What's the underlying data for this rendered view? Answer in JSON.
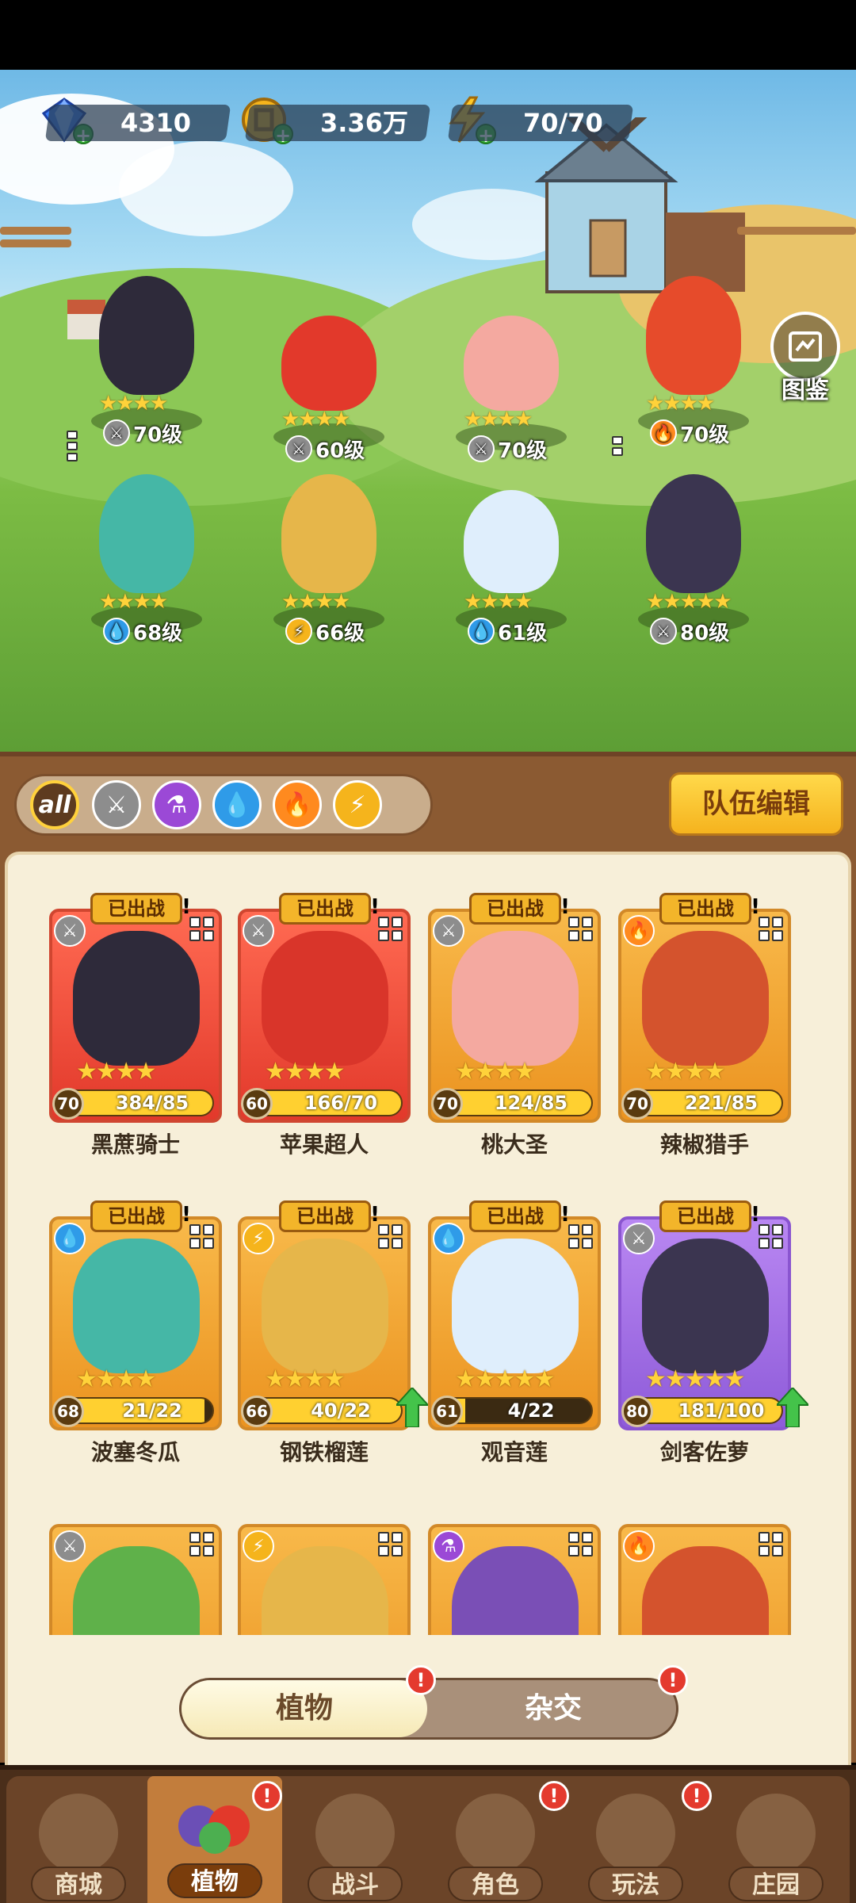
{
  "resources": {
    "gems": "4310",
    "coins": "3.36万",
    "energy": "70/70"
  },
  "atlas_label": "图鉴",
  "battle_units": [
    {
      "stars": "★★★★",
      "element": "sword",
      "level": "70级"
    },
    {
      "stars": "★★★★",
      "element": "sword",
      "level": "60级"
    },
    {
      "stars": "★★★★",
      "element": "sword",
      "level": "70级"
    },
    {
      "stars": "★★★★",
      "element": "fire",
      "level": "70级"
    },
    {
      "stars": "★★★★",
      "element": "water",
      "level": "68级"
    },
    {
      "stars": "★★★★",
      "element": "bolt",
      "level": "66级"
    },
    {
      "stars": "★★★★",
      "element": "water",
      "level": "61级"
    },
    {
      "stars": "★★★★★",
      "element": "sword",
      "level": "80级"
    }
  ],
  "filters": {
    "all_label": "all",
    "icons": [
      "sword-icon",
      "potion-icon",
      "water-icon",
      "fire-icon",
      "bolt-icon"
    ]
  },
  "team_edit_label": "队伍编辑",
  "cards": [
    {
      "tag": "已出战",
      "name": "黑蔗骑士",
      "level": "70",
      "progress": "384/85",
      "fill": 1.0,
      "stars": "★★★★",
      "color": "red",
      "element": "sword"
    },
    {
      "tag": "已出战",
      "name": "苹果超人",
      "level": "60",
      "progress": "166/70",
      "fill": 1.0,
      "stars": "★★★★",
      "color": "red",
      "element": "sword"
    },
    {
      "tag": "已出战",
      "name": "桃大圣",
      "level": "70",
      "progress": "124/85",
      "fill": 1.0,
      "stars": "★★★★",
      "color": "orange",
      "element": "sword"
    },
    {
      "tag": "已出战",
      "name": "辣椒猎手",
      "level": "70",
      "progress": "221/85",
      "fill": 1.0,
      "stars": "★★★★",
      "color": "orange",
      "element": "fire"
    },
    {
      "tag": "已出战",
      "name": "波塞冬瓜",
      "level": "68",
      "progress": "21/22",
      "fill": 0.95,
      "stars": "★★★★",
      "color": "orange",
      "element": "water"
    },
    {
      "tag": "已出战",
      "name": "钢铁榴莲",
      "level": "66",
      "progress": "40/22",
      "fill": 1.0,
      "stars": "★★★★",
      "color": "orange",
      "element": "bolt",
      "upgrade": true
    },
    {
      "tag": "已出战",
      "name": "观音莲",
      "level": "61",
      "progress": "4/22",
      "fill": 0.18,
      "stars": "★★★★★",
      "color": "orange",
      "element": "water"
    },
    {
      "tag": "已出战",
      "name": "剑客佐萝",
      "level": "80",
      "progress": "181/100",
      "fill": 1.0,
      "stars": "★★★★★",
      "color": "purple",
      "element": "sword",
      "upgrade": true
    }
  ],
  "partial_cards": [
    {
      "element": "sword"
    },
    {
      "element": "bolt"
    },
    {
      "element": "potion"
    },
    {
      "element": "fire"
    }
  ],
  "toggle": {
    "plants": "植物",
    "hybrid": "杂交",
    "badge": "!"
  },
  "nav": [
    {
      "label": "商城"
    },
    {
      "label": "植物"
    },
    {
      "label": "战斗"
    },
    {
      "label": "角色"
    },
    {
      "label": "玩法"
    },
    {
      "label": "庄园"
    }
  ],
  "colors": {
    "accent": "#ffd13c",
    "wood": "#8b5a32",
    "panel": "#f7efd9"
  }
}
